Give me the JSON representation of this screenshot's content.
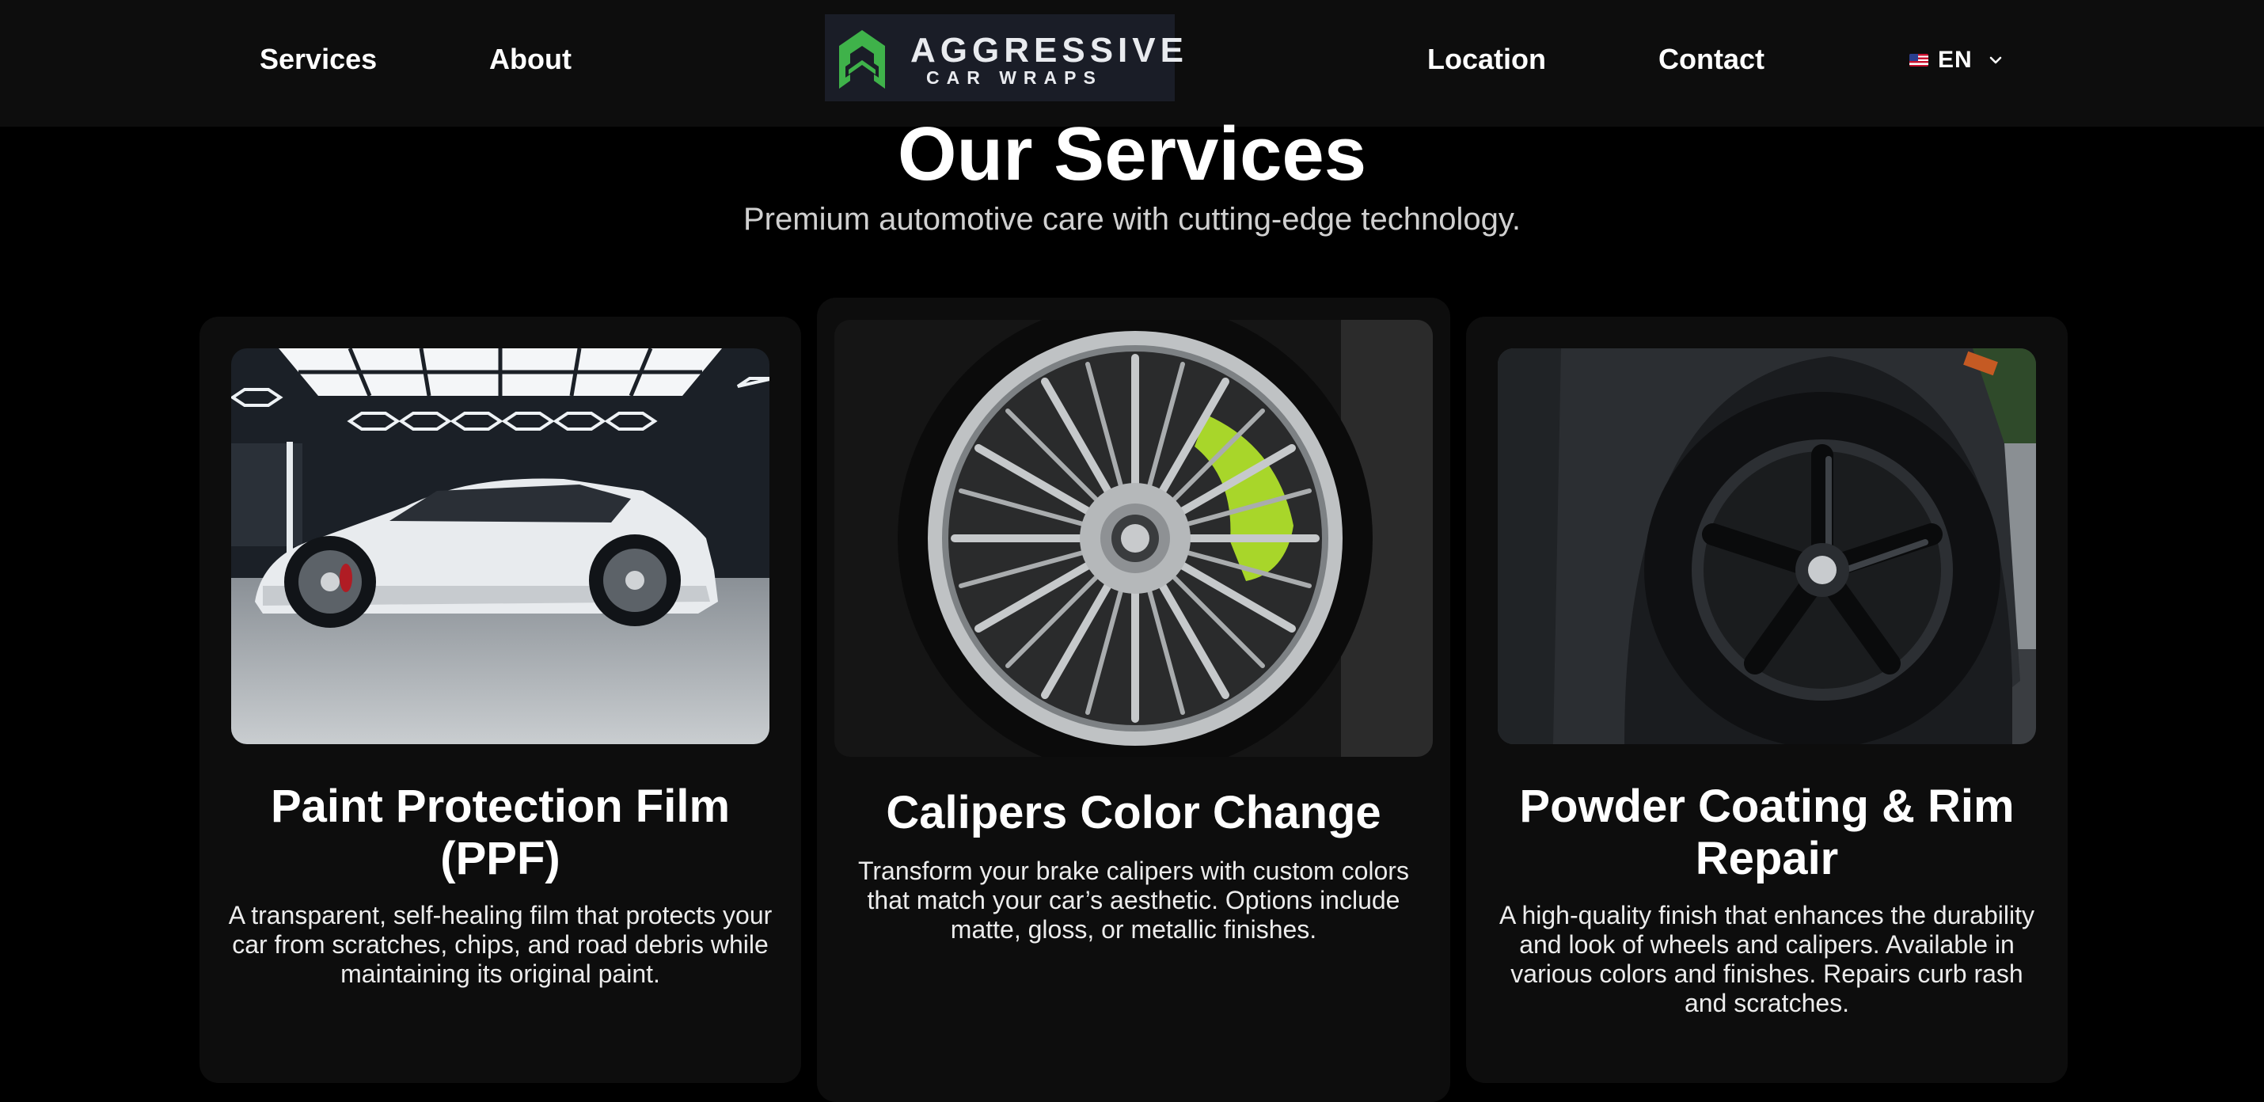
{
  "nav": {
    "services_label": "Services",
    "about_label": "About",
    "location_label": "Location",
    "contact_label": "Contact",
    "language_label": "EN",
    "language_flag_icon": "us-flag-icon"
  },
  "logo": {
    "line1": "AGGRESSIVE",
    "line2": "CAR WRAPS",
    "mark_color": "#3fb24a"
  },
  "section": {
    "title": "Our Services",
    "subtitle": "Premium automotive care with cutting-edge technology."
  },
  "services": [
    {
      "title": "Paint Protection Film (PPF)",
      "description": "A transparent, self-healing film that protects your car from scratches, chips, and road debris while maintaining its original paint."
    },
    {
      "title": "Calipers Color Change",
      "description": "Transform your brake calipers with custom colors that match your car’s aesthetic. Options include matte, gloss, or metallic finishes."
    },
    {
      "title": "Powder Coating & Rim Repair",
      "description": "A high-quality finish that enhances the durability and look of wheels and calipers. Available in various colors and finishes. Repairs curb rash and scratches."
    }
  ],
  "colors": {
    "page_background": "#000000",
    "header_background": "#0d0d0d",
    "card_background": "#0d0d0d",
    "caliper_accent": "#a8d62a"
  }
}
